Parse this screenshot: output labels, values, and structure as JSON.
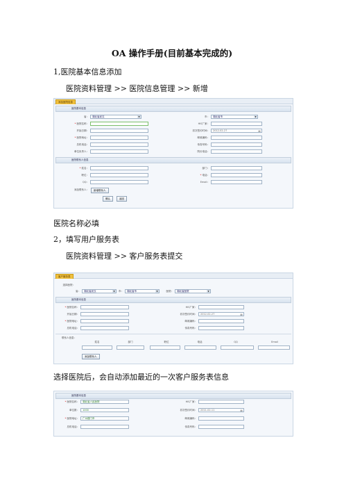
{
  "doc": {
    "title": "OA 操作手册(目前基本完成的)",
    "s1_heading": "1,医院基本信息添加",
    "s1_path": "医院资料管理 >> 医院信息管理 >> 新增",
    "s1_note": "医院名称必填",
    "s2_heading": "2，填写用户服务表",
    "s2_path": "医院资料管理 >> 客户服务表提交",
    "s2_note": "选择医院后，会自动添加最近的一次客户服务表信息"
  },
  "shot1": {
    "tab": "添加医院信息",
    "section_basic": "医院基本信息",
    "section_contact": "医院联系人信息",
    "province_label": "省：",
    "province_value": "湖北省武汉",
    "city_label": "市：",
    "city_value": "湖北省市",
    "name_label": "医院名称：",
    "his_label": "HIS厂家：",
    "unit_label": "开始日期：",
    "date_label": "初次签约时间：",
    "date_value": "2012-02-27",
    "addr_label": "医院地址：",
    "web_label": "邮政编码：",
    "tel_label": "总机电话：",
    "fax_label": "传真号码：",
    "leader_label": "单位负责人：",
    "remark_label": "院长电话：",
    "cname_label": "姓名：",
    "dept_label": "部门：",
    "post_label": "职位：",
    "phone_label": "电话：",
    "qq_label": "QQ：",
    "email_label": "Email：",
    "add_contact_label": "添加联系人：",
    "add_contact_btn": "新增联系人",
    "save_btn": "确认",
    "back_btn": "返回"
  },
  "shot2": {
    "tab": "客户服务表",
    "select_label": "选择医院：",
    "province_label": "省：",
    "province_value": "湖北省武汉",
    "city_label": "市：",
    "city_value": "湖北省市",
    "hospital_label": "医院：",
    "hospital_value": "湖北省医院",
    "section_basic": "医院基本信息",
    "name_label": "医院名称：",
    "his_label": "HIS厂家：",
    "unit_label": "开始日期：",
    "date_label": "初次签约时间：",
    "date_value": "2012-02-27",
    "addr_label": "医院地址：",
    "web_label": "邮政编码：",
    "tel_label": "总机电话：",
    "fax_label": "传真号码：",
    "contact_label": "联系人信息：",
    "col_name": "姓名",
    "col_dept": "部门",
    "col_post": "职位",
    "col_phone": "电话",
    "col_qq": "QQ",
    "col_email": "Email",
    "add_contact_btn": "添加联系人"
  },
  "shot3": {
    "section_basic": "医院基本信息",
    "name_label": "医院名称：",
    "name_value": "湖北省人民医院",
    "his_label": "HIS厂家：",
    "unit_label": "单位数：",
    "unit_value": "1000",
    "date_label": "初次签约时间：",
    "date_value": "2011-02-11",
    "addr_label": "医院地址：",
    "addr_value": "广州德门市",
    "web_label": "邮政编码：",
    "tel_label": "总机电话：",
    "fax_label": "传真号码："
  }
}
